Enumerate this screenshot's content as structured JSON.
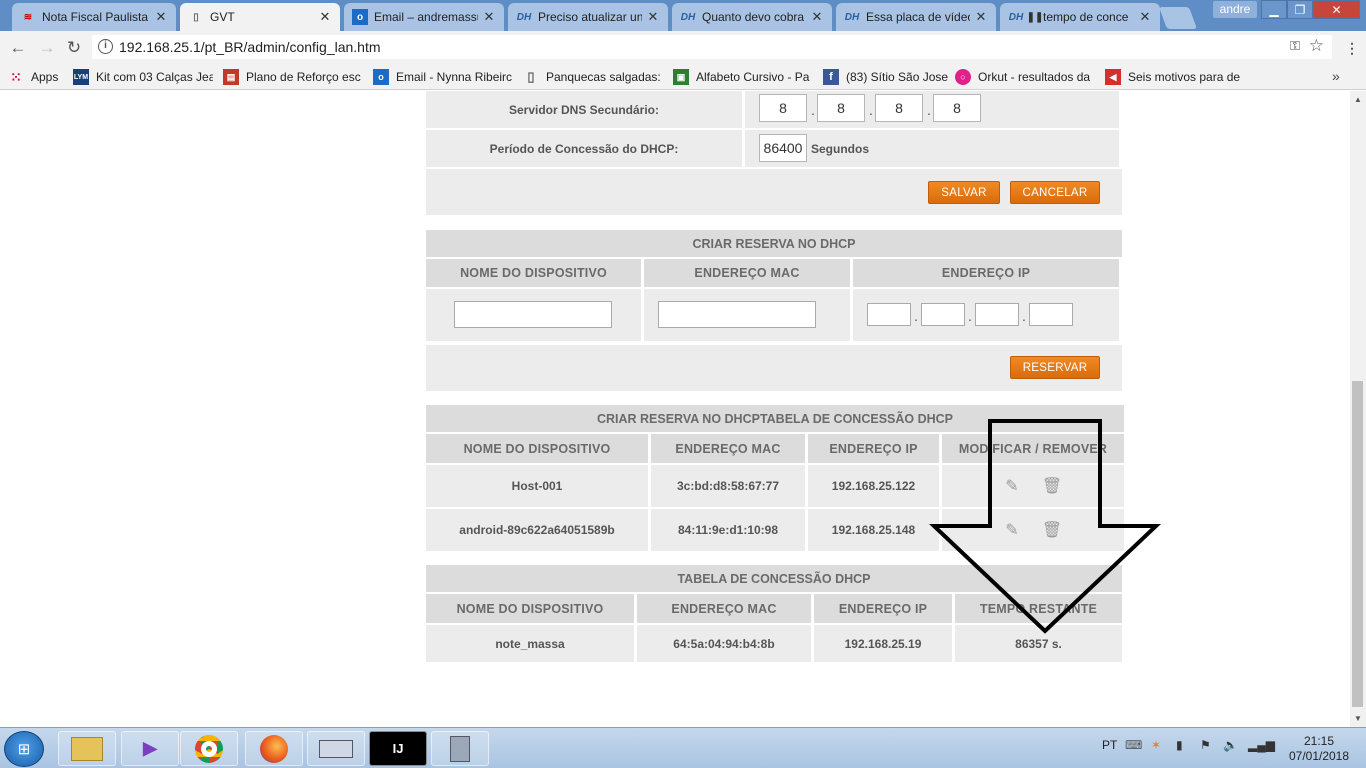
{
  "browser": {
    "tabs": [
      {
        "label": "Nota Fiscal Paulista",
        "icon": "flag-icon",
        "active": false
      },
      {
        "label": "GVT",
        "icon": "page-icon",
        "active": true
      },
      {
        "label": "Email – andremassu",
        "icon": "outlook-icon",
        "active": false
      },
      {
        "label": "Preciso atualizar un",
        "icon": "dh-icon",
        "active": false
      },
      {
        "label": "Quanto devo cobra",
        "icon": "dh-icon",
        "active": false
      },
      {
        "label": "Essa placa de vídeo",
        "icon": "dh-icon",
        "active": false
      },
      {
        "label": "tempo de conce",
        "icon": "dh-icon",
        "active": false
      }
    ],
    "window_user": "andre",
    "url": "192.168.25.1/pt_BR/admin/config_lan.htm",
    "bookmarks": [
      {
        "label": "Apps",
        "icon": "apps-grid-icon"
      },
      {
        "label": "Kit com 03 Calças Jea",
        "icon": "lym-icon"
      },
      {
        "label": "Plano de Reforço esc",
        "icon": "books-icon"
      },
      {
        "label": "Email - Nynna Ribeirc",
        "icon": "outlook-icon"
      },
      {
        "label": "Panquecas salgadas:",
        "icon": "page-icon"
      },
      {
        "label": "Alfabeto Cursivo - Pa",
        "icon": "book-icon"
      },
      {
        "label": "(83) Sítio São Jose",
        "icon": "facebook-icon"
      },
      {
        "label": "Orkut - resultados da",
        "icon": "orkut-icon"
      },
      {
        "label": "Seis motivos para de",
        "icon": "megaphone-icon"
      }
    ]
  },
  "lan_settings": {
    "dns_secondary_label": "Servidor DNS Secundário:",
    "dns_secondary": [
      "8",
      "8",
      "8",
      "8"
    ],
    "lease_period_label": "Período de Concessão do DHCP:",
    "lease_period_value": "86400",
    "lease_period_unit": "Segundos",
    "save_label": "SALVAR",
    "cancel_label": "CANCELAR"
  },
  "reservation_form": {
    "title": "CRIAR RESERVA NO DHCP",
    "columns": [
      "NOME DO DISPOSITIVO",
      "ENDEREÇO MAC",
      "ENDEREÇO IP"
    ],
    "reserve_label": "RESERVAR"
  },
  "reservations_table": {
    "title": "CRIAR RESERVA NO DHCPTABELA DE CONCESSÃO DHCP",
    "columns": [
      "NOME DO DISPOSITIVO",
      "ENDEREÇO MAC",
      "ENDEREÇO IP",
      "MODIFICAR / REMOVER"
    ],
    "rows": [
      {
        "name": "Host-001",
        "mac": "3c:bd:d8:58:67:77",
        "ip": "192.168.25.122"
      },
      {
        "name": "android-89c622a64051589b",
        "mac": "84:11:9e:d1:10:98",
        "ip": "192.168.25.148"
      }
    ]
  },
  "lease_table": {
    "title": "TABELA DE CONCESSÃO DHCP",
    "columns": [
      "NOME DO DISPOSITIVO",
      "ENDEREÇO MAC",
      "ENDEREÇO IP",
      "TEMPO RESTANTE"
    ],
    "rows": [
      {
        "name": "note_massa",
        "mac": "64:5a:04:94:b4:8b",
        "ip": "192.168.25.19",
        "remaining": "86357 s."
      }
    ]
  },
  "taskbar": {
    "language": "PT",
    "time": "21:15",
    "date": "07/01/2018",
    "apps": [
      "explorer-icon",
      "visual-studio-icon",
      "chrome-icon",
      "firefox-icon",
      "keyboard-icon",
      "intellij-icon",
      "calculator-icon"
    ]
  }
}
